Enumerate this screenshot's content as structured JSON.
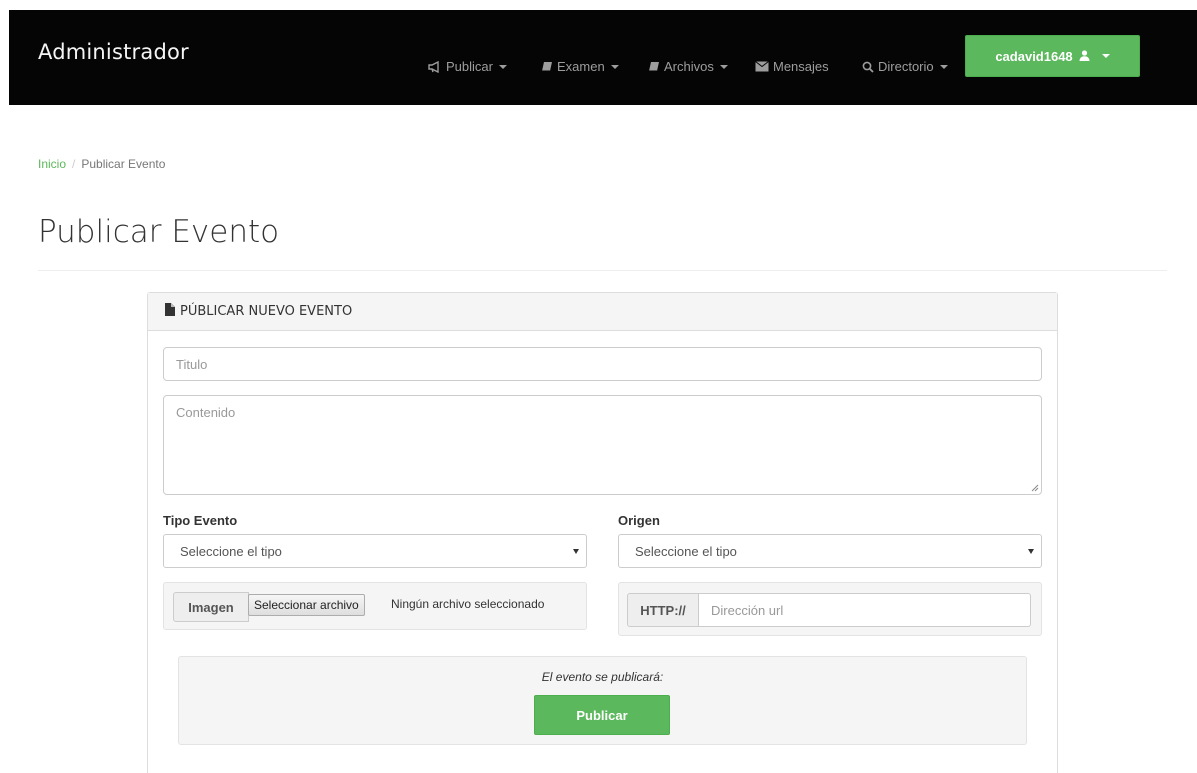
{
  "navbar": {
    "brand": "Administrador",
    "items": [
      {
        "label": "Publicar",
        "icon": "bullhorn-icon"
      },
      {
        "label": "Examen",
        "icon": "book-icon"
      },
      {
        "label": "Archivos",
        "icon": "book-icon"
      },
      {
        "label": "Mensajes",
        "icon": "envelope-icon"
      },
      {
        "label": "Directorio",
        "icon": "search-icon"
      }
    ],
    "user": {
      "label": "cadavid1648",
      "icon": "user-icon"
    }
  },
  "breadcrumb": {
    "home": "Inicio",
    "separator": "/",
    "current": "Publicar Evento"
  },
  "page_title": "Publicar Evento",
  "panel": {
    "heading": "PÚBLICAR NUEVO EVENTO",
    "heading_icon": "file-icon",
    "titulo_placeholder": "Titulo",
    "contenido_placeholder": "Contenido",
    "tipo_evento": {
      "label": "Tipo Evento",
      "selected": "Seleccione el tipo"
    },
    "origen": {
      "label": "Origen",
      "selected": "Seleccione el tipo"
    },
    "imagen": {
      "addon": "Imagen",
      "button": "Seleccionar archivo",
      "status": "Ningún archivo seleccionado"
    },
    "url": {
      "addon": "HTTP://",
      "placeholder": "Dirección url"
    },
    "publish": {
      "note": "El evento se publicará:",
      "button": "Publicar"
    }
  },
  "colors": {
    "accent": "#5cb85c",
    "navbar": "#050505"
  }
}
